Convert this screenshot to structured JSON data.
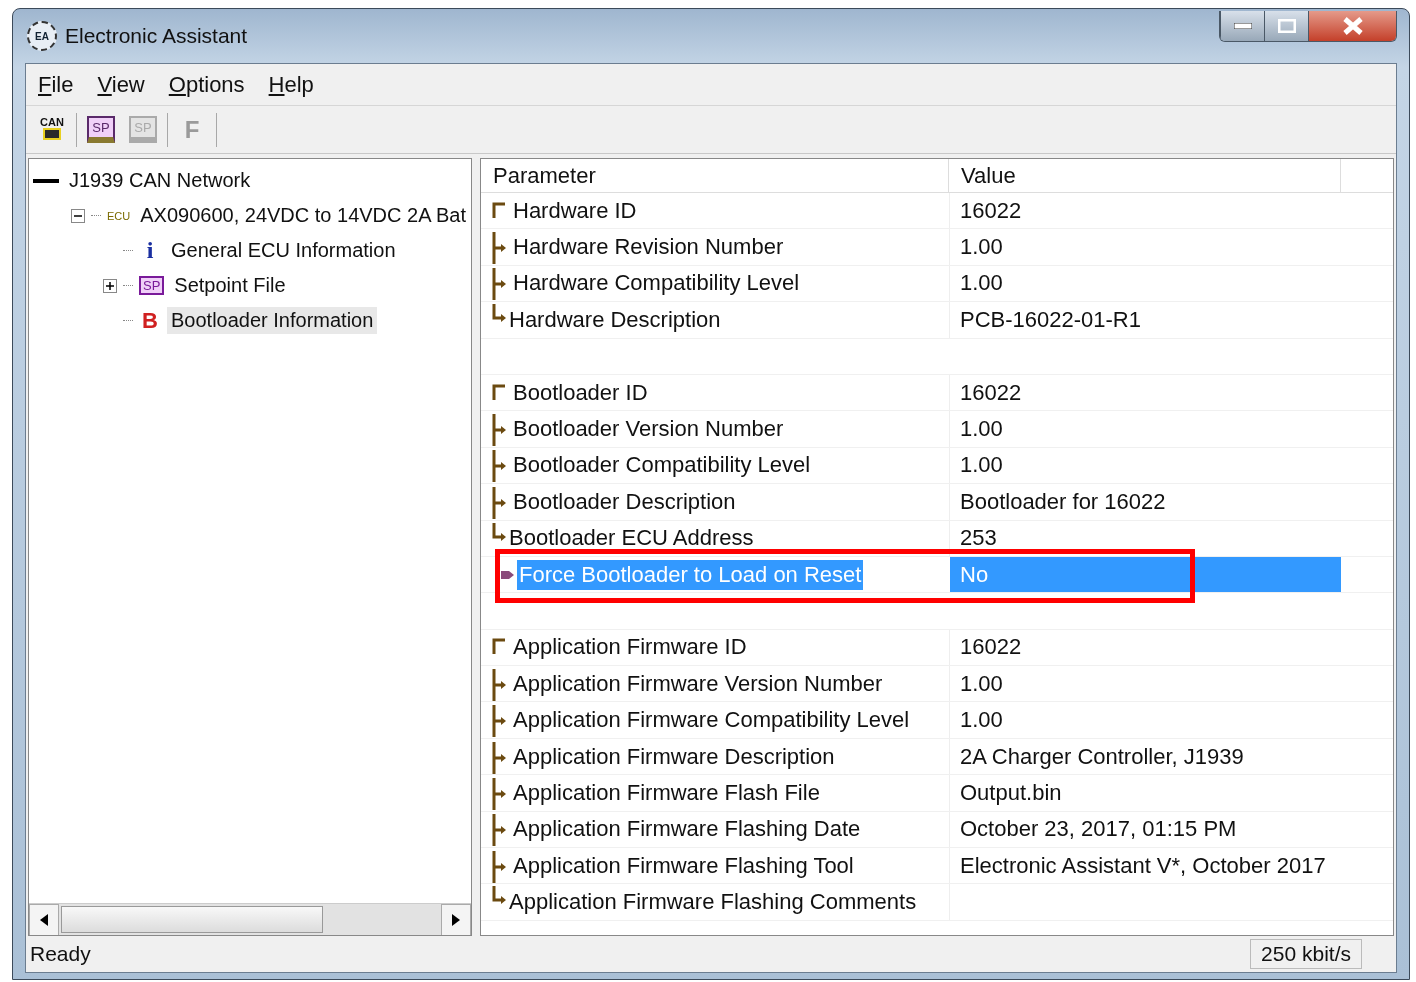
{
  "window": {
    "title": "Electronic Assistant",
    "logo_text": "EA"
  },
  "menu": [
    {
      "label": "File"
    },
    {
      "label": "View"
    },
    {
      "label": "Options"
    },
    {
      "label": "Help"
    }
  ],
  "toolbar": [
    {
      "kind": "can",
      "text": "CAN",
      "disabled": false
    },
    {
      "kind": "sp-open",
      "text": "SP",
      "disabled": false
    },
    {
      "kind": "sp-save",
      "text": "SP",
      "disabled": true
    },
    {
      "kind": "letter",
      "text": "F",
      "disabled": true
    }
  ],
  "tree": [
    {
      "label": "J1939 CAN Network",
      "kind": "network",
      "selected": false,
      "children": [
        {
          "label": "AX090600, 24VDC to 14VDC 2A Bat",
          "kind": "ecu",
          "icon_text": "ECU",
          "expanded": true,
          "selected": false,
          "children": [
            {
              "label": "General ECU Information",
              "kind": "info",
              "icon_text": "i",
              "selected": false
            },
            {
              "label": "Setpoint File",
              "kind": "setpoint",
              "icon_text": "SP",
              "expanded": false,
              "selected": false
            },
            {
              "label": "Bootloader Information",
              "kind": "bootloader",
              "icon_text": "B",
              "selected": true
            }
          ]
        }
      ]
    }
  ],
  "table": {
    "columns": [
      "Parameter",
      "Value"
    ],
    "rows": [
      {
        "kind": "first",
        "parameter": "Hardware ID",
        "value": "16022",
        "selected": false
      },
      {
        "kind": "middle",
        "parameter": "Hardware Revision Number",
        "value": "1.00",
        "selected": false
      },
      {
        "kind": "middle",
        "parameter": "Hardware Compatibility Level",
        "value": "1.00",
        "selected": false
      },
      {
        "kind": "last",
        "parameter": "Hardware Description",
        "value": "PCB-16022-01-R1",
        "selected": false
      },
      {
        "kind": "blank"
      },
      {
        "kind": "first",
        "parameter": "Bootloader ID",
        "value": "16022",
        "selected": false
      },
      {
        "kind": "middle",
        "parameter": "Bootloader Version Number",
        "value": "1.00",
        "selected": false
      },
      {
        "kind": "middle",
        "parameter": "Bootloader Compatibility Level",
        "value": "1.00",
        "selected": false
      },
      {
        "kind": "middle",
        "parameter": "Bootloader Description",
        "value": "Bootloader for 16022",
        "selected": false
      },
      {
        "kind": "last",
        "parameter": "Bootloader ECU Address",
        "value": "253",
        "selected": false
      },
      {
        "kind": "single",
        "parameter": "Force Bootloader to Load on Reset",
        "value": "No",
        "selected": true,
        "highlighted": true
      },
      {
        "kind": "blank"
      },
      {
        "kind": "first",
        "parameter": "Application Firmware ID",
        "value": "16022",
        "selected": false
      },
      {
        "kind": "middle",
        "parameter": "Application Firmware Version Number",
        "value": "1.00",
        "selected": false
      },
      {
        "kind": "middle",
        "parameter": "Application Firmware Compatibility Level",
        "value": "1.00",
        "selected": false
      },
      {
        "kind": "middle",
        "parameter": "Application Firmware Description",
        "value": "2A Charger Controller, J1939",
        "selected": false
      },
      {
        "kind": "middle",
        "parameter": "Application Firmware Flash File",
        "value": "Output.bin",
        "selected": false
      },
      {
        "kind": "middle",
        "parameter": "Application Firmware Flashing Date",
        "value": "October 23, 2017, 01:15 PM",
        "selected": false
      },
      {
        "kind": "middle",
        "parameter": "Application Firmware Flashing Tool",
        "value": "Electronic Assistant V*, October 2017",
        "selected": false
      },
      {
        "kind": "last",
        "parameter": "Application Firmware Flashing Comments",
        "selected": false
      }
    ]
  },
  "status_bar": {
    "text": "Ready",
    "bitrate": "250 kbit/s"
  }
}
